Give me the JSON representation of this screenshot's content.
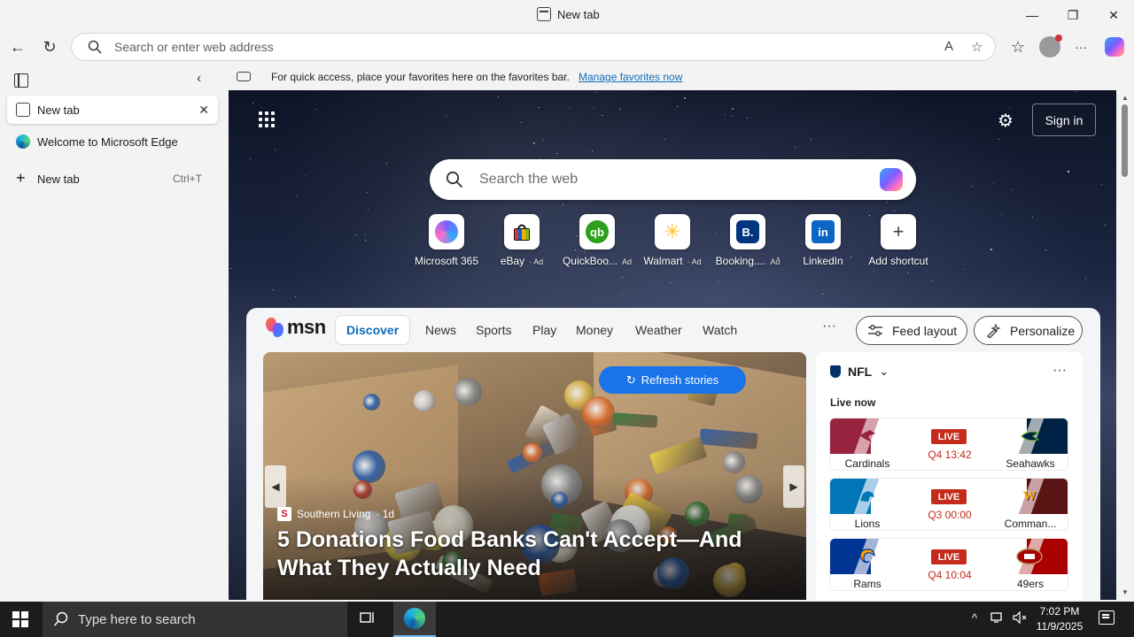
{
  "window": {
    "title": "New tab",
    "minimize_glyph": "—",
    "maximize_glyph": "❐",
    "close_glyph": "✕"
  },
  "nav": {
    "back_glyph": "←",
    "refresh_glyph": "↻",
    "address_placeholder": "Search or enter web address",
    "read_aloud_glyph": "A",
    "favorite_glyph": "☆",
    "favorites_glyph": "☆",
    "more_glyph": "···"
  },
  "sidebar": {
    "collapse_glyph": "‹",
    "tabs": [
      {
        "label": "New tab",
        "close_glyph": "✕"
      },
      {
        "label": "Welcome to Microsoft Edge"
      }
    ],
    "new_tab": {
      "glyph": "+",
      "label": "New tab",
      "shortcut": "Ctrl+T"
    }
  },
  "favorites_bar": {
    "text": "For quick access, place your favorites here on the favorites bar.",
    "link": "Manage favorites now"
  },
  "ntp": {
    "signin_label": "Sign in",
    "settings_glyph": "⚙",
    "search_placeholder": "Search the web",
    "shortcuts": [
      {
        "label": "Microsoft 365",
        "ad": "",
        "icon": "microsoft-365-icon",
        "color": "#7b61ff"
      },
      {
        "label": "eBay",
        "ad": "· Ad",
        "icon": "ebay-icon",
        "color": "#e53238"
      },
      {
        "label": "QuickBoo...",
        "ad": "Ad",
        "icon": "quickbooks-icon",
        "color": "#2ca01c"
      },
      {
        "label": "Walmart",
        "ad": "· Ad",
        "icon": "walmart-icon",
        "color": "#0071ce"
      },
      {
        "label": "Booking....",
        "ad": "Ad",
        "icon": "booking-icon",
        "color": "#003580"
      },
      {
        "label": "LinkedIn",
        "ad": "",
        "icon": "linkedin-icon",
        "color": "#0a66c2"
      },
      {
        "label": "Add shortcut",
        "ad": "",
        "icon": "plus-icon",
        "color": "#ffffff"
      }
    ],
    "shortcut_glyphs": {
      "quickbooks": "qb",
      "booking": "B.",
      "linkedin": "in",
      "walmart": "✳",
      "add": "+"
    }
  },
  "msn": {
    "wordmark": "msn",
    "tabs": [
      "Discover",
      "News",
      "Sports",
      "Play",
      "Money",
      "Weather",
      "Watch"
    ],
    "more_glyph": "···",
    "feed_layout_label": "Feed layout",
    "personalize_label": "Personalize",
    "refresh_label": "Refresh stories",
    "hero": {
      "source": "Southern Living",
      "age": "· 1d",
      "headline": "5 Donations Food Banks Can't Accept—And What They Actually Need",
      "prev_glyph": "◀",
      "next_glyph": "▶"
    },
    "nfl": {
      "title": "NFL",
      "chevron": "⌄",
      "more_glyph": "···",
      "live_now": "Live now",
      "live_badge": "LIVE",
      "games": [
        {
          "home": "Cardinals",
          "away": "Seahawks",
          "clock": "Q4 13:42",
          "home_color": "#97233f",
          "away_color": "#002244",
          "away_accent": "#69be28"
        },
        {
          "home": "Lions",
          "away": "Comman...",
          "clock": "Q3 00:00",
          "home_color": "#0076b6",
          "away_color": "#5a1414",
          "away_accent": "#ffb612"
        },
        {
          "home": "Rams",
          "away": "49ers",
          "clock": "Q4 10:04",
          "home_color": "#003594",
          "away_color": "#aa0000",
          "away_accent": "#b3995d"
        }
      ]
    }
  },
  "taskbar": {
    "search_placeholder": "Type here to search",
    "time": "7:02 PM",
    "date": "11/9/2025",
    "tray_chevron": "^"
  },
  "colors": {
    "accent": "#0f6cbd",
    "live_red": "#c42b1c",
    "refresh_blue": "#1a73e8"
  }
}
